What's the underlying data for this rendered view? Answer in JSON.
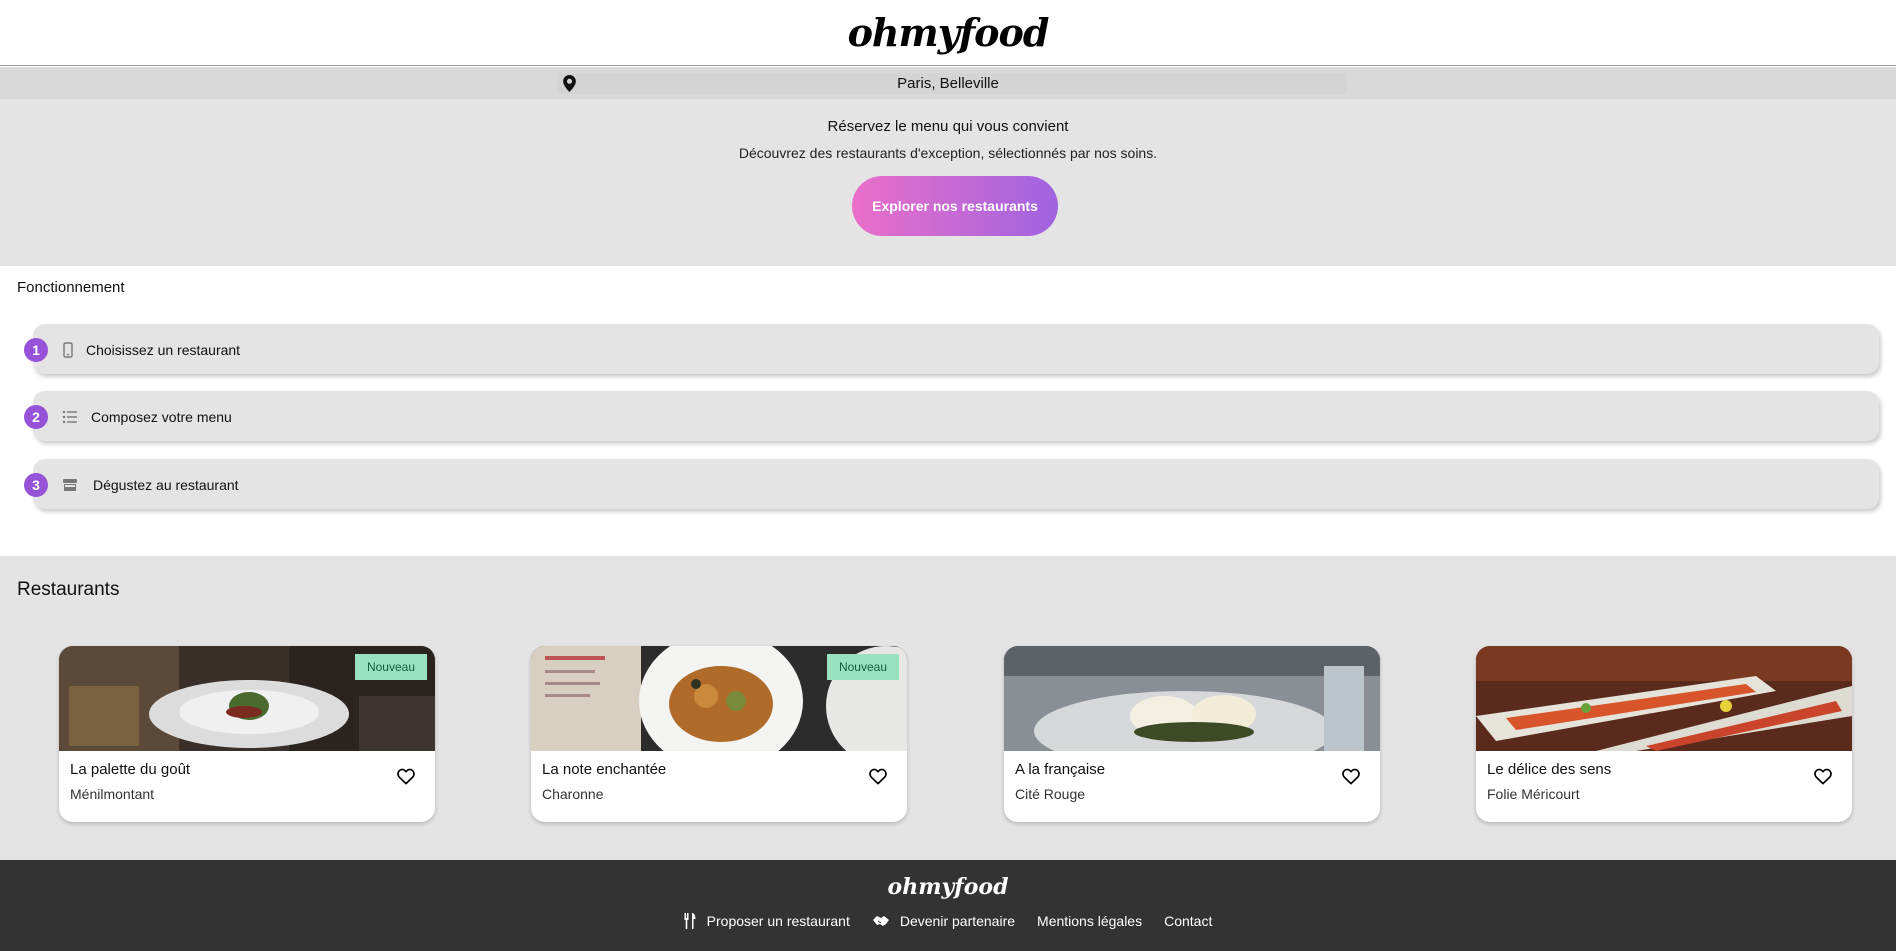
{
  "header": {
    "logo": "ohmyfood"
  },
  "location": {
    "text": "Paris, Belleville"
  },
  "hero": {
    "title": "Réservez le menu qui vous convient",
    "subtitle": "Découvrez des restaurants d'exception, sélectionnés par nos soins.",
    "cta_label": "Explorer nos restaurants"
  },
  "how_it_works": {
    "title": "Fonctionnement",
    "steps": [
      {
        "number": "1",
        "icon": "phone-icon",
        "label": "Choisissez un restaurant"
      },
      {
        "number": "2",
        "icon": "list-icon",
        "label": "Composez votre menu"
      },
      {
        "number": "3",
        "icon": "store-icon",
        "label": "Dégustez au restaurant"
      }
    ]
  },
  "restaurants": {
    "title": "Restaurants",
    "items": [
      {
        "name": "La palette du goût",
        "area": "Ménilmontant",
        "badge": "Nouveau"
      },
      {
        "name": "La note enchantée",
        "area": "Charonne",
        "badge": "Nouveau"
      },
      {
        "name": "A la française",
        "area": "Cité Rouge",
        "badge": ""
      },
      {
        "name": "Le délice des sens",
        "area": "Folie Méricourt",
        "badge": ""
      }
    ]
  },
  "footer": {
    "logo": "ohmyfood",
    "links": [
      {
        "label": "Proposer un restaurant",
        "icon": "utensils-icon"
      },
      {
        "label": "Devenir partenaire",
        "icon": "handshake-icon"
      },
      {
        "label": "Mentions légales",
        "icon": ""
      },
      {
        "label": "Contact",
        "icon": ""
      }
    ]
  },
  "colors": {
    "accent_purple": "#9753d8",
    "gradient_start": "#ea6fc9",
    "gradient_end": "#a063e0",
    "badge_green": "#99e2c1",
    "footer_bg": "#333333"
  }
}
